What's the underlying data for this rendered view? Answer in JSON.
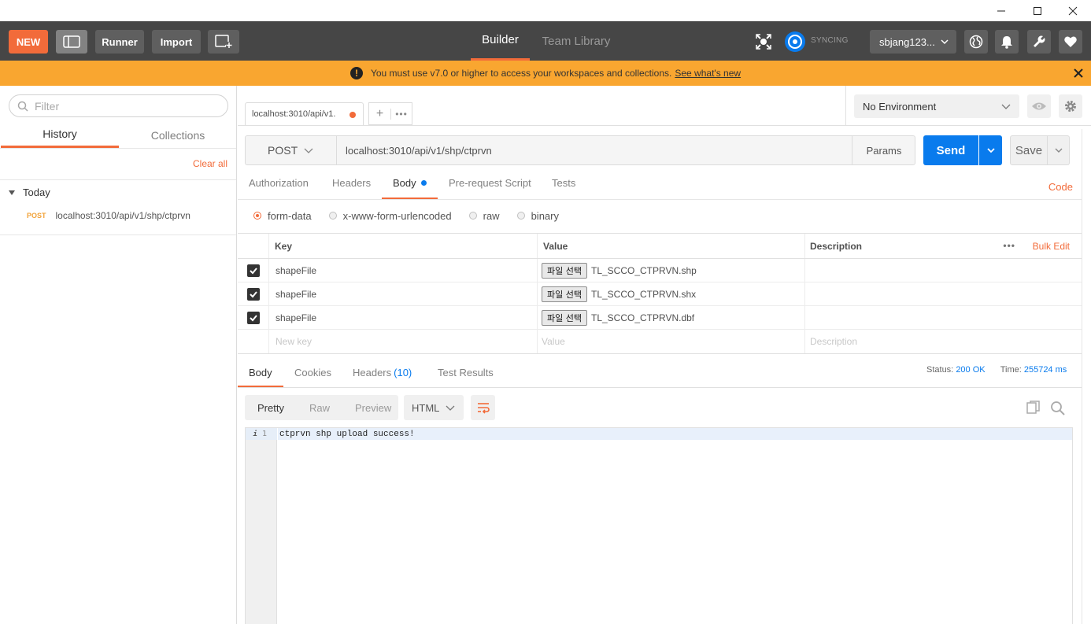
{
  "window": {
    "min": "—",
    "max": "☐",
    "close": "✕"
  },
  "header": {
    "new_label": "NEW",
    "runner_label": "Runner",
    "import_label": "Import",
    "tabs": [
      {
        "label": "Builder",
        "active": true
      },
      {
        "label": "Team Library",
        "active": false
      }
    ],
    "sync_label": "SYNCING",
    "user": "sbjang123...",
    "icons": [
      "interceptor-icon",
      "sync-icon",
      "globe-icon",
      "bell-icon",
      "wrench-icon",
      "heart-icon"
    ]
  },
  "banner": {
    "message": "You must use v7.0 or higher to access your workspaces and collections.",
    "link": "See what's new"
  },
  "sidebar": {
    "filter_placeholder": "Filter",
    "tabs": [
      "History",
      "Collections"
    ],
    "clear_all": "Clear all",
    "group": "Today",
    "history": [
      {
        "method": "POST",
        "url": "localhost:3010/api/v1/shp/ctprvn"
      }
    ]
  },
  "request_tab": {
    "label": "localhost:3010/api/v1."
  },
  "environment": {
    "selected": "No Environment"
  },
  "request": {
    "method": "POST",
    "url": "localhost:3010/api/v1/shp/ctprvn",
    "params_label": "Params",
    "send_label": "Send",
    "save_label": "Save"
  },
  "req_tabs": [
    "Authorization",
    "Headers",
    "Body",
    "Pre-request Script",
    "Tests"
  ],
  "code_link": "Code",
  "body_modes": [
    {
      "label": "form-data",
      "selected": true
    },
    {
      "label": "x-www-form-urlencoded",
      "selected": false
    },
    {
      "label": "raw",
      "selected": false
    },
    {
      "label": "binary",
      "selected": false
    }
  ],
  "form_table": {
    "headers": {
      "key": "Key",
      "value": "Value",
      "description": "Description",
      "bulk_edit": "Bulk Edit"
    },
    "file_button": "파일 선택",
    "rows": [
      {
        "key": "shapeFile",
        "value": "TL_SCCO_CTPRVN.shp",
        "description": ""
      },
      {
        "key": "shapeFile",
        "value": "TL_SCCO_CTPRVN.shx",
        "description": ""
      },
      {
        "key": "shapeFile",
        "value": "TL_SCCO_CTPRVN.dbf",
        "description": ""
      }
    ],
    "placeholders": {
      "key": "New key",
      "value": "Value",
      "description": "Description"
    }
  },
  "response": {
    "tabs": [
      "Body",
      "Cookies",
      "Headers",
      "Test Results"
    ],
    "headers_count": "(10)",
    "status_label": "Status:",
    "status_value": "200 OK",
    "time_label": "Time:",
    "time_value": "255724 ms",
    "view_modes": [
      "Pretty",
      "Raw",
      "Preview"
    ],
    "format": "HTML",
    "line_number": "1",
    "body": "ctprvn shp upload success!"
  },
  "colors": {
    "accent": "#f26b3a",
    "primary": "#097bed",
    "banner": "#f9a630",
    "header": "#464646"
  }
}
